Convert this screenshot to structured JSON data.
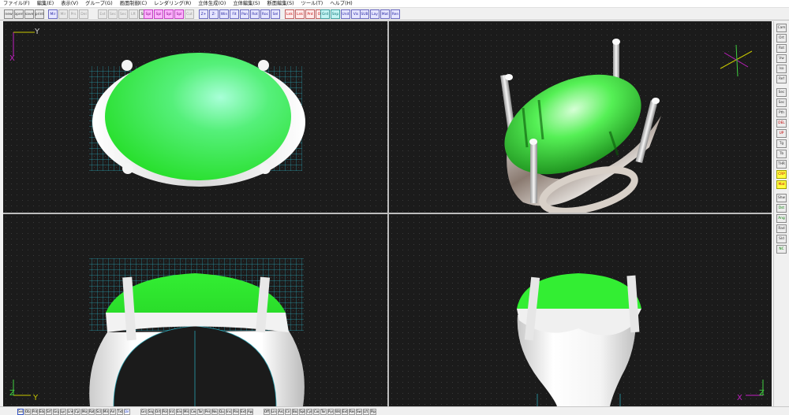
{
  "menubar": {
    "items": [
      "ファイル(F)",
      "編集(E)",
      "表示(V)",
      "グループ(G)",
      "画面制御(C)",
      "レンダリング(R)",
      "立体生成(O)",
      "立体編集(S)",
      "断面編集(S)",
      "ツール(T)",
      "ヘルプ(H)"
    ]
  },
  "toolbar": {
    "buttons": [
      "new",
      "open",
      "save",
      "print",
      "Mir",
      "Mir",
      "Prs",
      "Del",
      "Ext",
      "Sec",
      "Sec",
      "Lft",
      "Sol",
      "Spl",
      "Spl",
      "Spl",
      "Spl",
      "Cut",
      "Z+",
      "Z-",
      "Win",
      "Fit",
      "Pan",
      "Rot",
      "Roc",
      "Sel",
      "Lnk",
      "Lnk",
      "Pnt",
      "Off",
      "Grd",
      "Snp",
      "Unit",
      "Vis",
      "SUB",
      "Lay",
      "Mat",
      "Ren"
    ]
  },
  "viewports": {
    "top": {
      "axis_h": "Y",
      "axis_v": "X"
    },
    "perspective": {},
    "front": {
      "axis_v": "Z",
      "axis_h": "Y"
    },
    "side": {
      "axis_v": "Z",
      "axis_h": "X"
    }
  },
  "right_toolbar": {
    "buttons": [
      "Cam",
      "Ort",
      "Rot",
      "Vw",
      "Iso",
      "Ref",
      "Sec",
      "Sec",
      "Pth",
      "DEL",
      "UP",
      "Tg",
      "Tb",
      "THR",
      "CRP",
      "Mat",
      "Shw",
      "Dst",
      "Ang",
      "Rad",
      "Sld",
      "NC"
    ]
  },
  "statusbar": {
    "buttons": [
      "Sel",
      "Obj",
      "Pnt",
      "Edg",
      "Srf",
      "Grp",
      "Lyr",
      "Lnk",
      "Cpy",
      "Mov",
      "Rot",
      "Scl",
      "Mir",
      "Arr",
      "Txt",
      "Dim",
      "Grd",
      "Snp",
      "Ort",
      "Pol",
      "Int",
      "End",
      "Mid",
      "Cen",
      "Tan",
      "Per",
      "Nea",
      "Qua",
      "Ins",
      "Par",
      "Ext",
      "App",
      "Off",
      "Lin",
      "Arc",
      "Cir",
      "Box",
      "Sph",
      "Cyl",
      "Con",
      "Tor",
      "Pyr",
      "Wdg",
      "Ext",
      "Rev",
      "Swp",
      "Lft",
      "Pip"
    ]
  },
  "colors": {
    "gem": "#33ee33",
    "metal": "#e8e8e8",
    "grid": "#2aa0b0",
    "axis_yellow": "#c8c800",
    "axis_magenta": "#c020c0",
    "axis_green": "#40d040",
    "background": "#1b1b1b"
  }
}
